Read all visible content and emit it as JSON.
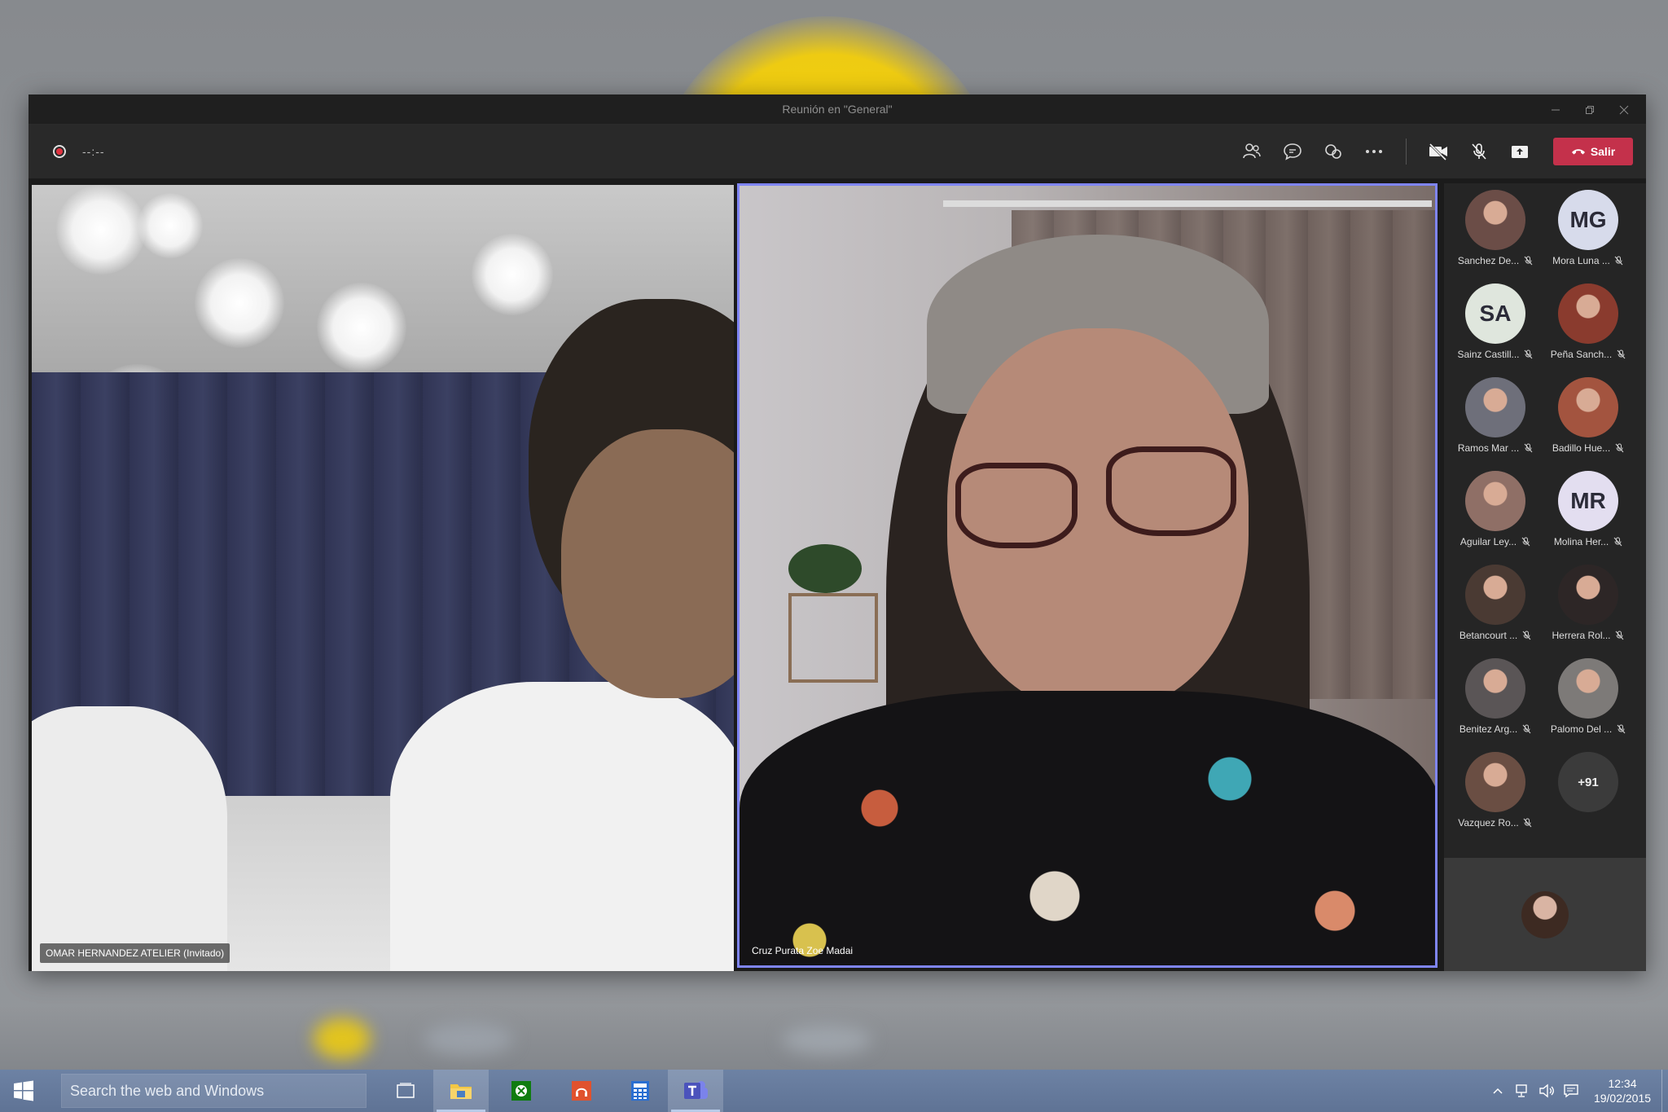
{
  "window": {
    "title": "Reunión en \"General\""
  },
  "toolbar": {
    "timer": "--:--",
    "leave_label": "Salir",
    "icons": [
      "participants-icon",
      "chat-icon",
      "reactions-icon",
      "more-icon",
      "camera-off-icon",
      "mic-off-icon",
      "share-icon"
    ]
  },
  "videos": {
    "left_name": "OMAR HERNANDEZ ATELIER (Invitado)",
    "right_name": "Cruz Purata Zoe Madai"
  },
  "roster": {
    "participants": [
      {
        "label": "Sanchez De...",
        "initials": "",
        "avatar_color": "#6b4d47"
      },
      {
        "label": "Mora Luna ...",
        "initials": "MG",
        "avatar_color": "#d7dbeb"
      },
      {
        "label": "Sainz Castill...",
        "initials": "SA",
        "avatar_color": "#dfe6dd"
      },
      {
        "label": "Peña Sanch...",
        "initials": "",
        "avatar_color": "#8a3b2e"
      },
      {
        "label": "Ramos Mar ...",
        "initials": "",
        "avatar_color": "#6e6f7a"
      },
      {
        "label": "Badillo Hue...",
        "initials": "",
        "avatar_color": "#a3543f"
      },
      {
        "label": "Aguilar Ley...",
        "initials": "",
        "avatar_color": "#8f6f66"
      },
      {
        "label": "Molina Her...",
        "initials": "MR",
        "avatar_color": "#e3def0"
      },
      {
        "label": "Betancourt ...",
        "initials": "",
        "avatar_color": "#4a3a33"
      },
      {
        "label": "Herrera Rol...",
        "initials": "",
        "avatar_color": "#2d2626"
      },
      {
        "label": "Benitez Arg...",
        "initials": "",
        "avatar_color": "#5a5556"
      },
      {
        "label": "Palomo Del ...",
        "initials": "",
        "avatar_color": "#7d7a78"
      },
      {
        "label": "Vazquez Ro...",
        "initials": "",
        "avatar_color": "#6a4e43"
      }
    ],
    "more_count": "+91"
  },
  "taskbar": {
    "search_placeholder": "Search the web and Windows",
    "time": "12:34",
    "date": "19/02/2015",
    "apps": [
      "task-view-icon",
      "file-explorer-icon",
      "xbox-icon",
      "music-icon",
      "calculator-icon",
      "teams-icon"
    ]
  },
  "colors": {
    "accent": "#7f85f5",
    "leave": "#c4314b",
    "taskbar": "#6679a0"
  }
}
